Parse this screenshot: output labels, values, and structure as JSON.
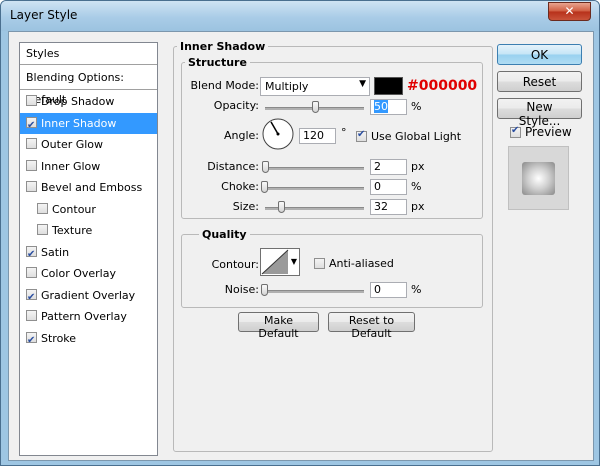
{
  "window": {
    "title": "Layer Style",
    "close_label": "✕"
  },
  "left_panel": {
    "header": "Styles",
    "blending_options": "Blending Options: Default",
    "items": [
      {
        "label": "Drop Shadow",
        "checked": false,
        "selected": false,
        "indent": false
      },
      {
        "label": "Inner Shadow",
        "checked": true,
        "selected": true,
        "indent": false
      },
      {
        "label": "Outer Glow",
        "checked": false,
        "selected": false,
        "indent": false
      },
      {
        "label": "Inner Glow",
        "checked": false,
        "selected": false,
        "indent": false
      },
      {
        "label": "Bevel and Emboss",
        "checked": false,
        "selected": false,
        "indent": false
      },
      {
        "label": "Contour",
        "checked": false,
        "selected": false,
        "indent": true
      },
      {
        "label": "Texture",
        "checked": false,
        "selected": false,
        "indent": true
      },
      {
        "label": "Satin",
        "checked": true,
        "selected": false,
        "indent": false
      },
      {
        "label": "Color Overlay",
        "checked": false,
        "selected": false,
        "indent": false
      },
      {
        "label": "Gradient Overlay",
        "checked": true,
        "selected": false,
        "indent": false
      },
      {
        "label": "Pattern Overlay",
        "checked": false,
        "selected": false,
        "indent": false
      },
      {
        "label": "Stroke",
        "checked": true,
        "selected": false,
        "indent": false
      }
    ]
  },
  "inner_shadow": {
    "title": "Inner Shadow",
    "structure": {
      "title": "Structure",
      "blend_mode_label": "Blend Mode:",
      "blend_mode_value": "Multiply",
      "color_hex": "#000000",
      "color_hex_text": "#000000",
      "opacity_label": "Opacity:",
      "opacity_value": "50",
      "opacity_percent": 50,
      "opacity_unit": "%",
      "angle_label": "Angle:",
      "angle_value": "120",
      "angle_unit": "°",
      "use_global_light_label": "Use Global Light",
      "use_global_light": true,
      "distance_label": "Distance:",
      "distance_value": "2",
      "distance_unit": "px",
      "choke_label": "Choke:",
      "choke_value": "0",
      "choke_unit": "%",
      "size_label": "Size:",
      "size_value": "32",
      "size_unit": "px"
    },
    "quality": {
      "title": "Quality",
      "contour_label": "Contour:",
      "anti_aliased_label": "Anti-aliased",
      "anti_aliased": false,
      "noise_label": "Noise:",
      "noise_value": "0",
      "noise_unit": "%"
    },
    "make_default_label": "Make Default",
    "reset_default_label": "Reset to Default"
  },
  "right_panel": {
    "ok_label": "OK",
    "reset_label": "Reset",
    "new_style_label": "New Style...",
    "preview_label": "Preview",
    "preview_checked": true
  },
  "colors": {
    "accent": "#3399ff",
    "hex_text": "#e00000",
    "swatch": "#000000"
  }
}
